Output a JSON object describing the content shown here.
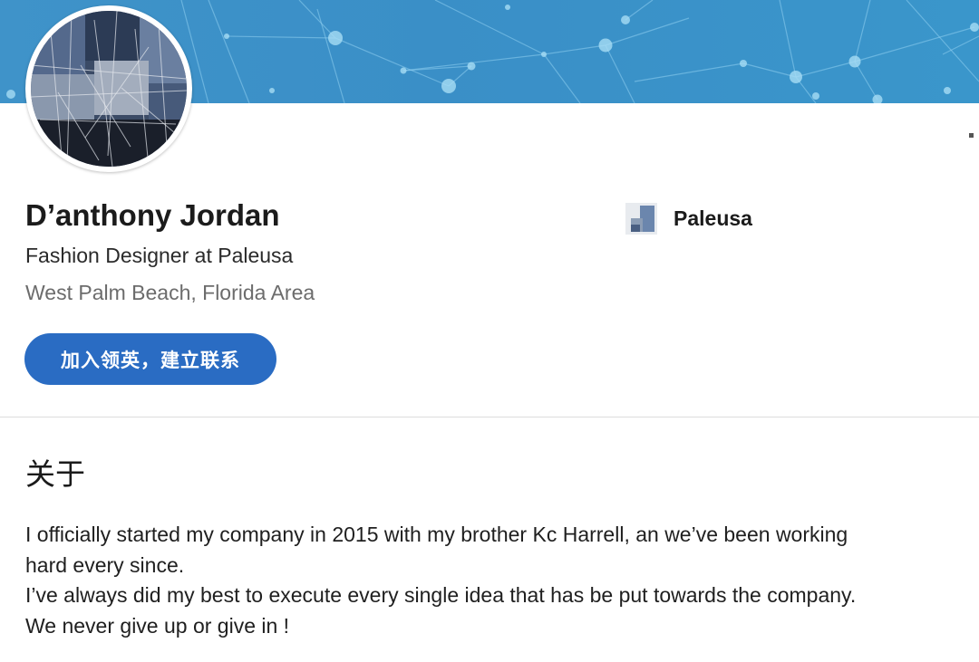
{
  "profile": {
    "name": "D’anthony Jordan",
    "headline": "Fashion Designer at Paleusa",
    "location": "West Palm Beach, Florida Area"
  },
  "actions": {
    "join_label": "加入领英，建立联系"
  },
  "company": {
    "name": "Paleusa"
  },
  "about": {
    "title": "关于",
    "lines": [
      "I officially started my company in 2015 with my brother Kc Harrell, an we’ve been working",
      "hard every since.",
      "I’ve always did my best to execute every single idea that has be put towards the company.",
      "We never give up or give in !"
    ]
  },
  "colors": {
    "banner": "#3a8fc7",
    "button": "#2a6cc3"
  }
}
